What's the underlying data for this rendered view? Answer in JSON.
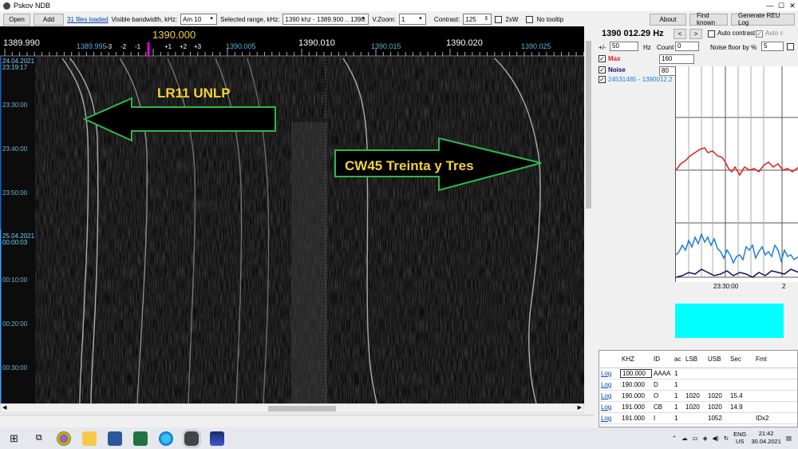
{
  "window": {
    "title": "Pskov NDB"
  },
  "toolbar": {
    "open": "Open",
    "add": "Add",
    "files_loaded": "31 files loaded",
    "vis_bw_label": "Visible bandwidth, kHz:",
    "vis_bw_value": "Am 10",
    "sel_range_label": "Selected range, kHz:",
    "sel_range_value": "1390 khz - 1389.900 .. 1390.",
    "vzoom_label": "V.Zoom:",
    "vzoom_value": "1",
    "contrast_label": "Contrast:",
    "contrast_value": "125",
    "x2w": "2xW",
    "no_tooltip": "No tooltip",
    "about": "About",
    "find_known": "Find known",
    "gen_reu": "Generate REU Log"
  },
  "freq_scale": {
    "labels": [
      "1389.990",
      "1389.995",
      "1390.005",
      "1390.010",
      "1390.015",
      "1390.020",
      "1390.025"
    ],
    "center": "1390.000",
    "offsets": [
      "-3",
      "-2",
      "-1",
      "+1",
      "+2",
      "+3"
    ]
  },
  "time_labels": [
    "24.04.2021",
    "23:19:17",
    "23:30:00",
    "23:40:00",
    "23:50:00",
    "25.04.2021",
    "00:00:03",
    "00:10:00",
    "00:20:00",
    "00:30:00"
  ],
  "callouts": {
    "lr11": "LR11 UNLP",
    "cw45": "CW45 Treinta y Tres"
  },
  "right_panel": {
    "freq": "1390 012.29 Hz",
    "nav_left": "<",
    "nav_right": ">",
    "auto_contrast": "Auto contrast",
    "auto_c2": "Auto c",
    "pm_label": "+/-",
    "pm_value": "50",
    "hz": "Hz",
    "count_label": "Count",
    "count_value": "0",
    "noise_floor_label": "Noise floor by %",
    "noise_floor_value": "5",
    "max_label": "Max",
    "max_value": "160",
    "noise_label": "Noise",
    "noise_value": "80",
    "trace_label": "24531485 - 1390012.2",
    "graph_time": "23:30:00",
    "graph_time_2": "2"
  },
  "table": {
    "headers": [
      "",
      "KHZ",
      "ID",
      "ac",
      "LSB",
      "USB",
      "Sec",
      "Fmt"
    ],
    "rows": [
      [
        "Log",
        "100.000",
        "AAAA",
        "1",
        "",
        "",
        "",
        ""
      ],
      [
        "Log",
        "190.000",
        "D",
        "1",
        "",
        "",
        "",
        ""
      ],
      [
        "Log",
        "190.000",
        "O",
        "1",
        "1020",
        "1020",
        "15.4",
        ""
      ],
      [
        "Log",
        "191.000",
        "CB",
        "1",
        "1020",
        "1020",
        "14.9",
        ""
      ],
      [
        "Log",
        "191.000",
        "I",
        "1",
        "",
        "1052",
        "",
        "IDx2"
      ]
    ]
  },
  "taskbar": {
    "lang": "ENG",
    "region": "US",
    "time": "21:42",
    "date": "30.04.2021"
  },
  "colors": {
    "max": "#e02020",
    "noise": "#1e7fd8",
    "noise_dark": "#101060",
    "cyan": "#00ffff",
    "callout_text": "#f3d23b",
    "arrow_stroke": "#2fb84a"
  }
}
